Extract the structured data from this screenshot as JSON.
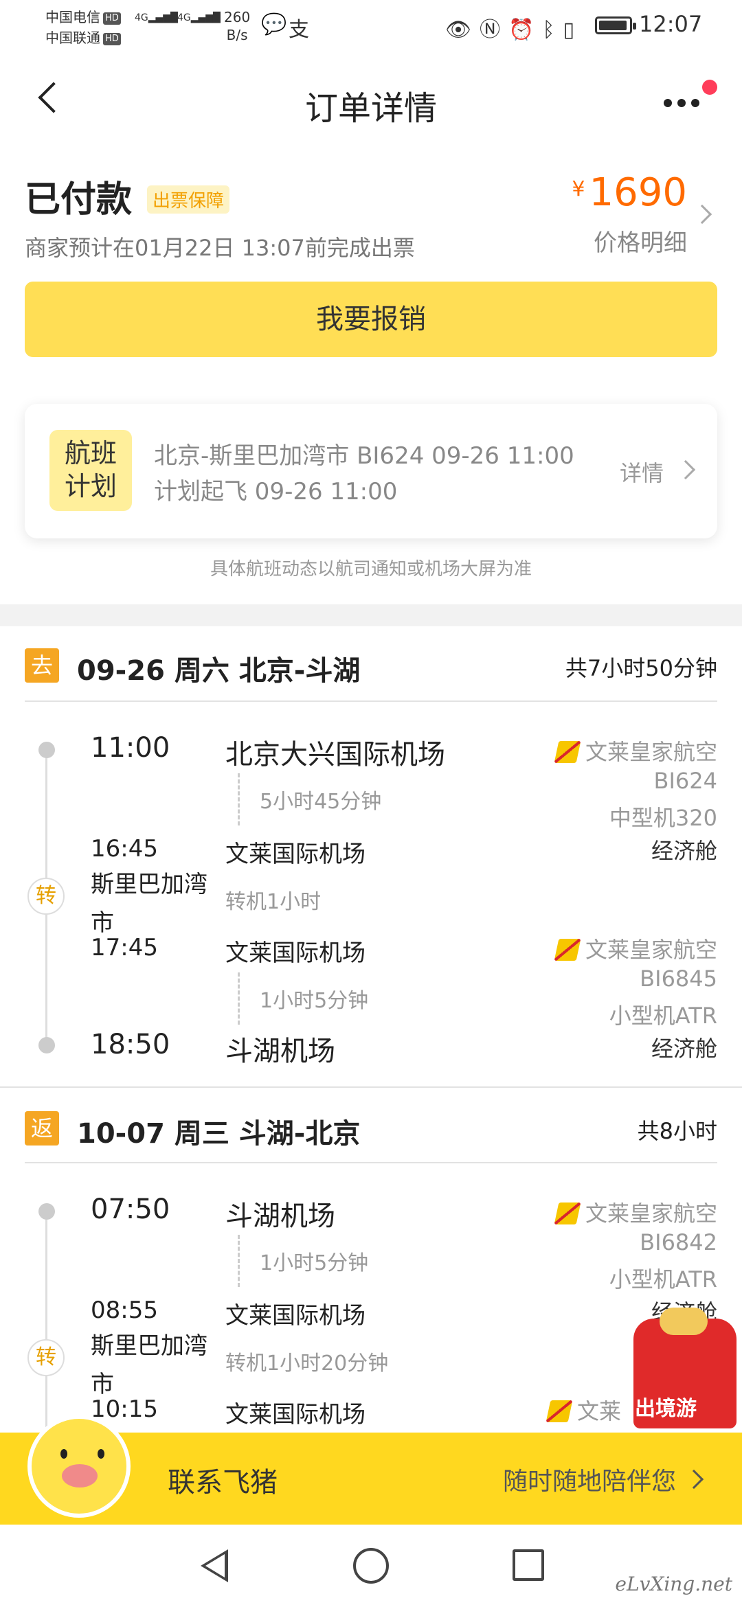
{
  "status_bar": {
    "carrier1": "中国电信",
    "carrier2": "中国联通",
    "hd": "HD",
    "net_speed_value": "260",
    "net_speed_unit": "B/s",
    "time": "12:07",
    "icons": [
      "eye-icon",
      "nfc-icon",
      "alarm-icon",
      "bluetooth-icon",
      "vibrate-icon",
      "battery-icon"
    ]
  },
  "nav": {
    "title": "订单详情"
  },
  "order": {
    "status": "已付款",
    "guarantee_tag": "出票保障",
    "issue_note": "商家预计在01月22日 13:07前完成出票",
    "currency": "¥",
    "price": "1690",
    "price_detail_label": "价格明细",
    "reimburse_button": "我要报销"
  },
  "flight_plan": {
    "badge_line1": "航班",
    "badge_line2": "计划",
    "line1": "北京-斯里巴加湾市 BI624 09-26 11:00",
    "line2": "计划起飞 09-26 11:00",
    "detail_label": "详情",
    "note": "具体航班动态以航司通知或机场大屏为准"
  },
  "outbound": {
    "tag": "去",
    "title": "09-26 周六 北京-斗湖",
    "total": "共7小时50分钟",
    "seg1": {
      "dep_time": "11:00",
      "dep_airport": "北京大兴国际机场",
      "duration": "5小时45分钟",
      "arr_time": "16:45",
      "arr_airport": "文莱国际机场",
      "airline": "文莱皇家航空",
      "flight_no": "BI624",
      "aircraft": "中型机320",
      "cabin": "经济舱"
    },
    "transfer": {
      "city_line1": "斯里巴加湾",
      "city_line2": "市",
      "label": "转机1小时",
      "glyph": "转"
    },
    "seg2": {
      "dep_time": "17:45",
      "dep_airport": "文莱国际机场",
      "duration": "1小时5分钟",
      "arr_time": "18:50",
      "arr_airport": "斗湖机场",
      "airline": "文莱皇家航空",
      "flight_no": "BI6845",
      "aircraft": "小型机ATR",
      "cabin": "经济舱"
    }
  },
  "inbound": {
    "tag": "返",
    "title": "10-07 周三 斗湖-北京",
    "total": "共8小时",
    "seg1": {
      "dep_time": "07:50",
      "dep_airport": "斗湖机场",
      "duration": "1小时5分钟",
      "arr_time": "08:55",
      "arr_airport": "文莱国际机场",
      "airline": "文莱皇家航空",
      "flight_no": "BI6842",
      "aircraft": "小型机ATR",
      "cabin": "经济舱"
    },
    "transfer": {
      "city_line1": "斯里巴加湾",
      "city_line2": "市",
      "label": "转机1小时20分钟",
      "glyph": "转"
    },
    "seg2": {
      "dep_time": "10:15",
      "dep_airport": "文莱国际机场",
      "airline_partial": "文莱"
    }
  },
  "promo": {
    "label": "出境游"
  },
  "contact": {
    "label": "联系飞猪",
    "sub": "随时随地陪伴您"
  },
  "watermark": "eLvXing.net",
  "colors": {
    "accent_yellow": "#ffde55",
    "price_orange": "#ff6a00",
    "tag_orange": "#f5a623"
  }
}
